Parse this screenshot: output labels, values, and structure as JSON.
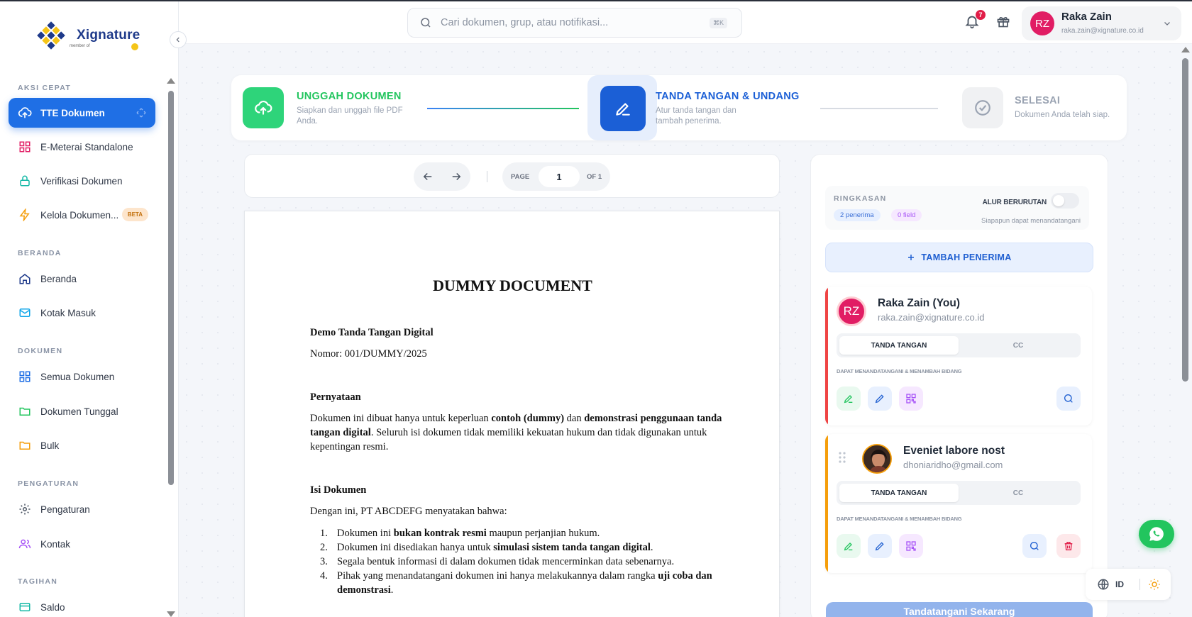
{
  "app": {
    "name": "Xignature",
    "subtitle": "member of"
  },
  "colors": {
    "primary": "#1f6fe5",
    "success": "#2ed47a",
    "danger": "#e11d48",
    "beta_bg": "#fde5cc",
    "card1_bar": "#ef4444",
    "card2_bar": "#f59e0b"
  },
  "sidebar": {
    "sections": {
      "aksi_cepat": "AKSI CEPAT",
      "beranda": "BERANDA",
      "dokumen": "DOKUMEN",
      "pengaturan": "PENGATURAN",
      "tagihan": "TAGIHAN"
    },
    "items": [
      {
        "label": "TTE Dokumen",
        "icon": "cloud-upload-icon",
        "active": true
      },
      {
        "label": "E-Meterai Standalone",
        "icon": "grid-icon"
      },
      {
        "label": "Verifikasi Dokumen",
        "icon": "lock-icon"
      },
      {
        "label": "Kelola Dokumen...",
        "icon": "bolt-icon",
        "badge": "BETA"
      },
      {
        "label": "Beranda",
        "icon": "home-icon"
      },
      {
        "label": "Kotak Masuk",
        "icon": "mail-icon"
      },
      {
        "label": "Semua Dokumen",
        "icon": "grid-icon"
      },
      {
        "label": "Dokumen Tunggal",
        "icon": "folder-icon"
      },
      {
        "label": "Bulk",
        "icon": "folder-icon"
      },
      {
        "label": "Pengaturan",
        "icon": "gear-icon"
      },
      {
        "label": "Kontak",
        "icon": "users-icon"
      },
      {
        "label": "Saldo",
        "icon": "card-icon"
      }
    ]
  },
  "header": {
    "search_placeholder": "Cari dokumen, grup, atau notifikasi...",
    "search_shortcut": "⌘K",
    "notif_count": "7",
    "user": {
      "initials": "RZ",
      "name": "Raka Zain",
      "email": "raka.zain@xignature.co.id"
    }
  },
  "stepper": [
    {
      "title": "UNGGAH DOKUMEN",
      "sub": "Siapkan dan unggah file PDF Anda.",
      "color": "#22c55e"
    },
    {
      "title": "TANDA TANGAN & UNDANG",
      "sub": "Atur tanda tangan dan tambah penerima.",
      "color": "#1b5fd6"
    },
    {
      "title": "SELESAI",
      "sub": "Dokumen Anda telah siap.",
      "color": "#9aa3b2"
    }
  ],
  "pager": {
    "label": "PAGE",
    "current": "1",
    "of": "OF 1"
  },
  "document": {
    "title": "DUMMY DOCUMENT",
    "subtitle": "Demo Tanda Tangan Digital",
    "nomor": "Nomor: 001/DUMMY/2025",
    "h_pernyataan": "Pernyataan",
    "p1_a": "Dokumen ini dibuat hanya untuk keperluan ",
    "p1_b": "contoh (dummy)",
    "p1_c": " dan ",
    "p1_d": "demonstrasi penggunaan tanda tangan digital",
    "p1_e": ". Seluruh isi dokumen tidak memiliki kekuatan hukum dan tidak digunakan untuk kepentingan resmi.",
    "h_isi": "Isi Dokumen",
    "intro": "Dengan ini, PT ABCDEFG menyatakan bahwa:",
    "list": [
      {
        "n": "1.",
        "a": "Dokumen ini ",
        "b": "bukan kontrak resmi",
        "c": " maupun perjanjian hukum."
      },
      {
        "n": "2.",
        "a": "Dokumen ini disediakan hanya untuk ",
        "b": "simulasi sistem tanda tangan digital",
        "c": "."
      },
      {
        "n": "3.",
        "a": "Segala bentuk informasi di dalam dokumen tidak mencerminkan data sebenarnya.",
        "b": "",
        "c": ""
      },
      {
        "n": "4.",
        "a": "Pihak yang menandatangani dokumen ini hanya melakukannya dalam rangka ",
        "b": "uji coba dan demonstrasi",
        "c": "."
      }
    ]
  },
  "panel": {
    "ringkasan": "RINGKASAN",
    "chip_penerima": "2 penerima",
    "chip_field": "0 field",
    "alur_label": "ALUR BERURUTAN",
    "alur_sub": "Siapapun dapat menandatangani",
    "alur_on": false,
    "add_button": "TAMBAH PENERIMA",
    "recipients": [
      {
        "initials": "RZ",
        "name": "Raka Zain (You)",
        "email": "raka.zain@xignature.co.id",
        "seg_on": "TANDA TANGAN",
        "seg_off": "CC",
        "perm": "DAPAT MENANDATANGANI & MENAMBAH BIDANG"
      },
      {
        "initials": "",
        "name": "Eveniet labore nost",
        "email": "dhoniaridho@gmail.com",
        "seg_on": "TANDA TANGAN",
        "seg_off": "CC",
        "perm": "DAPAT MENANDATANGANI & MENAMBAH BIDANG"
      }
    ],
    "sign_button": "Tandatangani Sekarang"
  },
  "lang": {
    "code": "ID"
  }
}
